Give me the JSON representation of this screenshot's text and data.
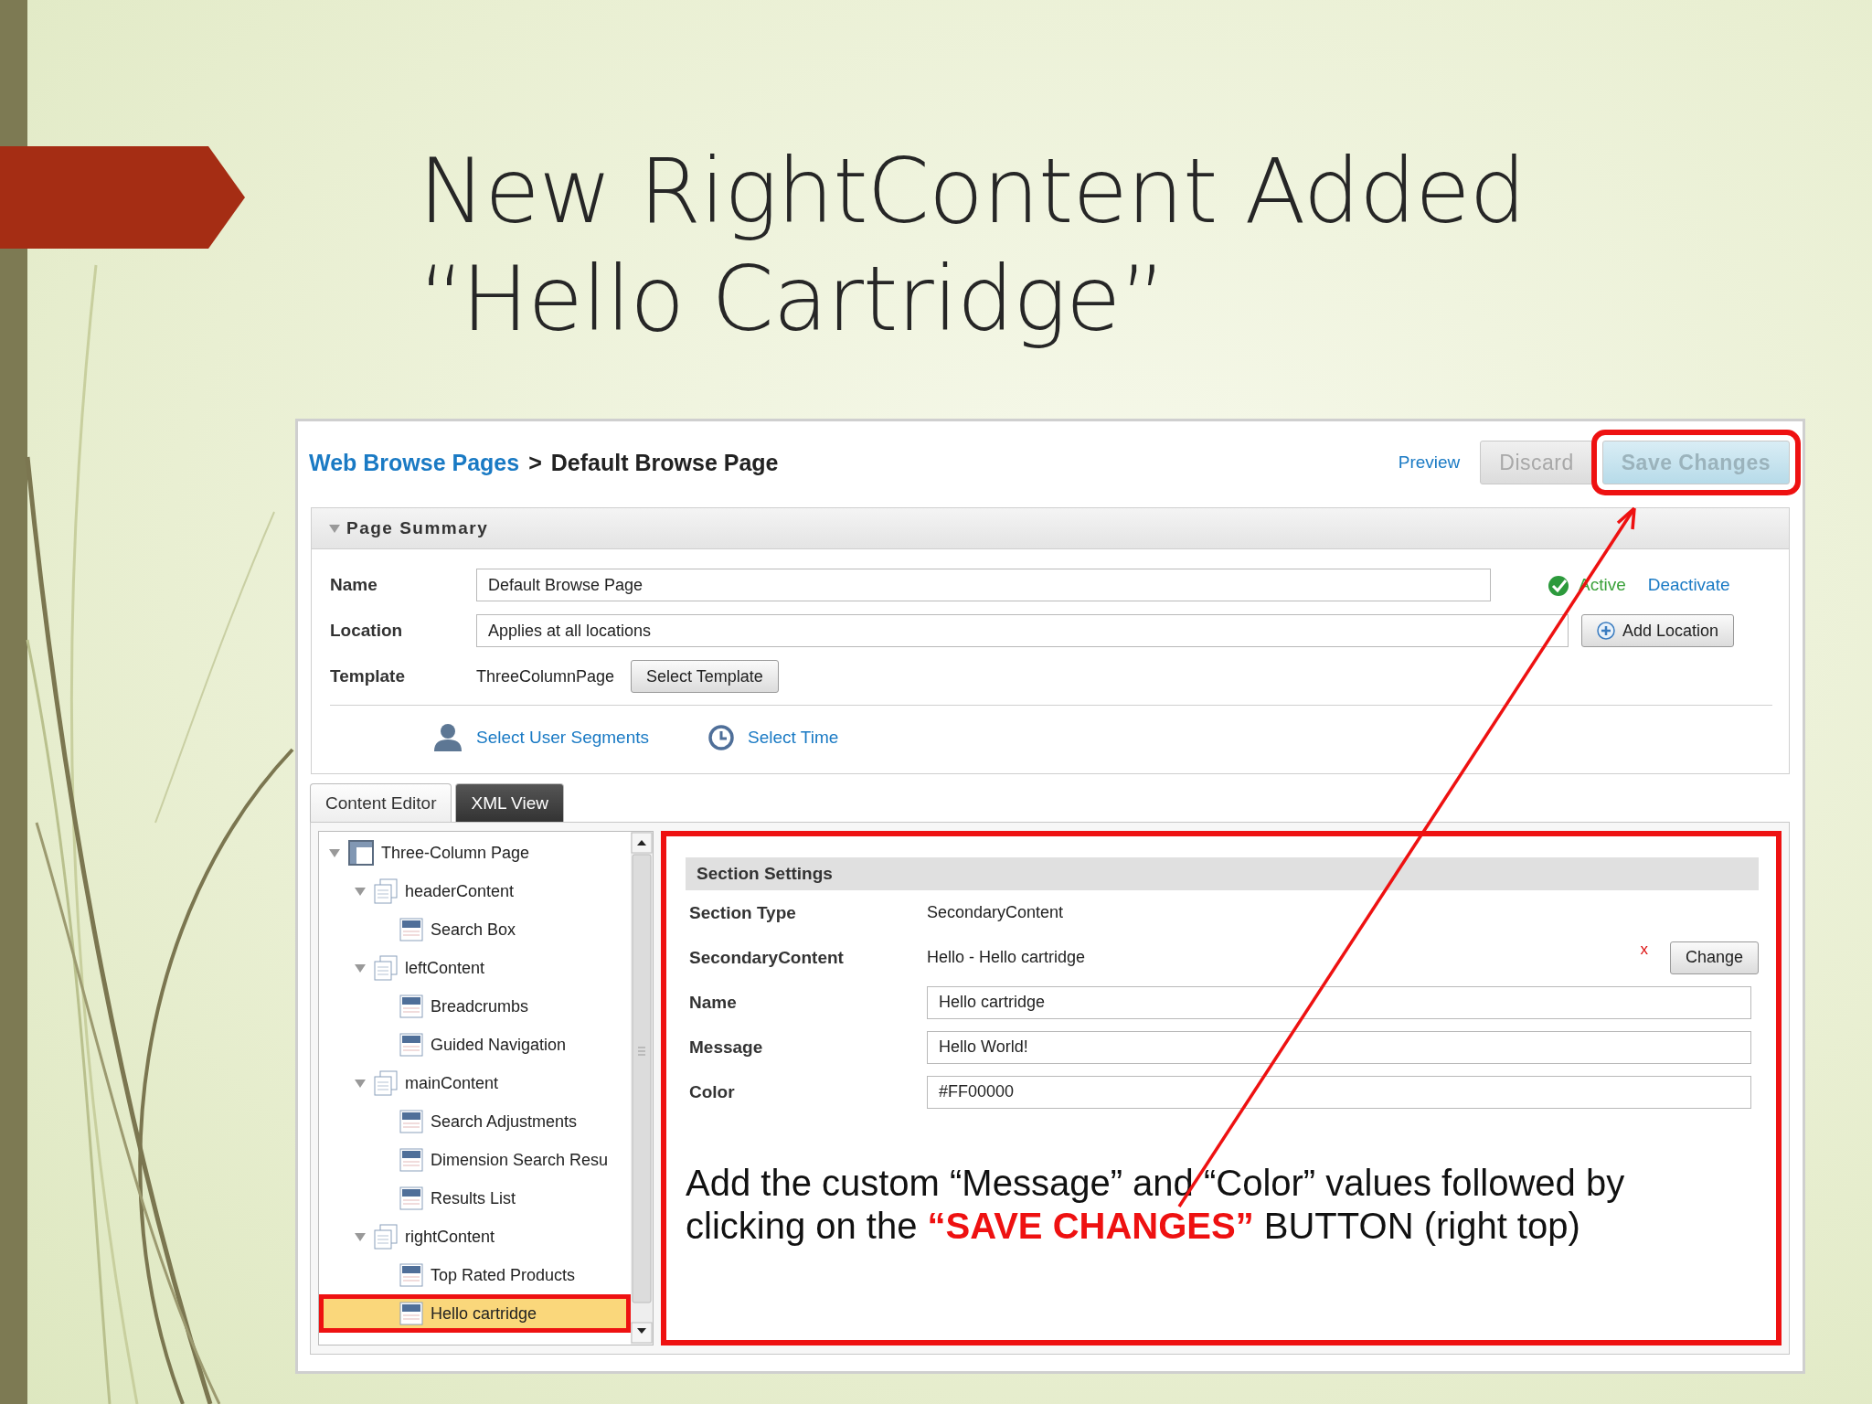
{
  "slide": {
    "title_lines": [
      "New RightContent Added",
      "“Hello Cartridge”"
    ]
  },
  "app": {
    "breadcrumb": {
      "parent": "Web Browse Pages",
      "separator": ">",
      "current": "Default Browse Page"
    },
    "preview_link": "Preview",
    "buttons": [
      {
        "label": "Discard",
        "kind": "plain",
        "highlighted": false
      },
      {
        "label": "Save Changes",
        "kind": "primary",
        "highlighted": true
      }
    ],
    "page_summary": {
      "title": "Page Summary",
      "expanded": true,
      "fields": [
        {
          "kind": "input",
          "label": "Name",
          "value": "Default Browse Page"
        },
        {
          "kind": "input",
          "label": "Location",
          "value": "Applies at all locations"
        },
        {
          "kind": "text",
          "label": "Template",
          "value": "ThreeColumnPage"
        }
      ],
      "status": {
        "label": "Active",
        "active": true
      },
      "deactivate_link": "Deactivate",
      "add_location_button": "Add Location",
      "select_template_button": "Select Template",
      "links": [
        {
          "kind": "user",
          "label": "Select User Segments"
        },
        {
          "kind": "clock",
          "label": "Select Time"
        }
      ]
    },
    "tabs": [
      {
        "label": "Content Editor",
        "selected": true
      },
      {
        "label": "XML View",
        "selected": false
      }
    ],
    "tree": [
      {
        "label": "Three-Column Page",
        "kind": "page",
        "expanded": true,
        "selected": false,
        "children": [
          {
            "label": "headerContent",
            "kind": "section",
            "expanded": true,
            "selected": false,
            "children": [
              {
                "label": "Search Box",
                "kind": "cartridge",
                "selected": false
              }
            ]
          },
          {
            "label": "leftContent",
            "kind": "section",
            "expanded": true,
            "selected": false,
            "children": [
              {
                "label": "Breadcrumbs",
                "kind": "cartridge",
                "selected": false
              },
              {
                "label": "Guided Navigation",
                "kind": "cartridge",
                "selected": false
              }
            ]
          },
          {
            "label": "mainContent",
            "kind": "section",
            "expanded": true,
            "selected": false,
            "children": [
              {
                "label": "Search Adjustments",
                "kind": "cartridge",
                "selected": false
              },
              {
                "label": "Dimension Search Resu",
                "kind": "cartridge",
                "selected": false
              },
              {
                "label": "Results List",
                "kind": "cartridge",
                "selected": false
              }
            ]
          },
          {
            "label": "rightContent",
            "kind": "section",
            "expanded": true,
            "selected": false,
            "children": [
              {
                "label": "Top Rated Products",
                "kind": "cartridge",
                "selected": false
              },
              {
                "label": "Hello cartridge",
                "kind": "cartridge",
                "selected": true,
                "highlighted": true
              }
            ]
          }
        ]
      }
    ],
    "section_settings": {
      "title": "Section Settings",
      "highlighted": true,
      "rows": [
        {
          "kind": "text",
          "label": "Section Type",
          "value": "SecondaryContent"
        },
        {
          "kind": "content",
          "label": "SecondaryContent",
          "value": "Hello - Hello cartridge",
          "remove": "x",
          "button": "Change"
        },
        {
          "kind": "input",
          "label": "Name",
          "value": "Hello cartridge"
        },
        {
          "kind": "input",
          "label": "Message",
          "value": "Hello World!"
        },
        {
          "kind": "input",
          "label": "Color",
          "value": "#FF00000"
        }
      ]
    },
    "annotation": "Add the custom “Message” and “Color” values followed by clicking on the **“SAVE CHANGES”** BUTTON (right top)"
  }
}
